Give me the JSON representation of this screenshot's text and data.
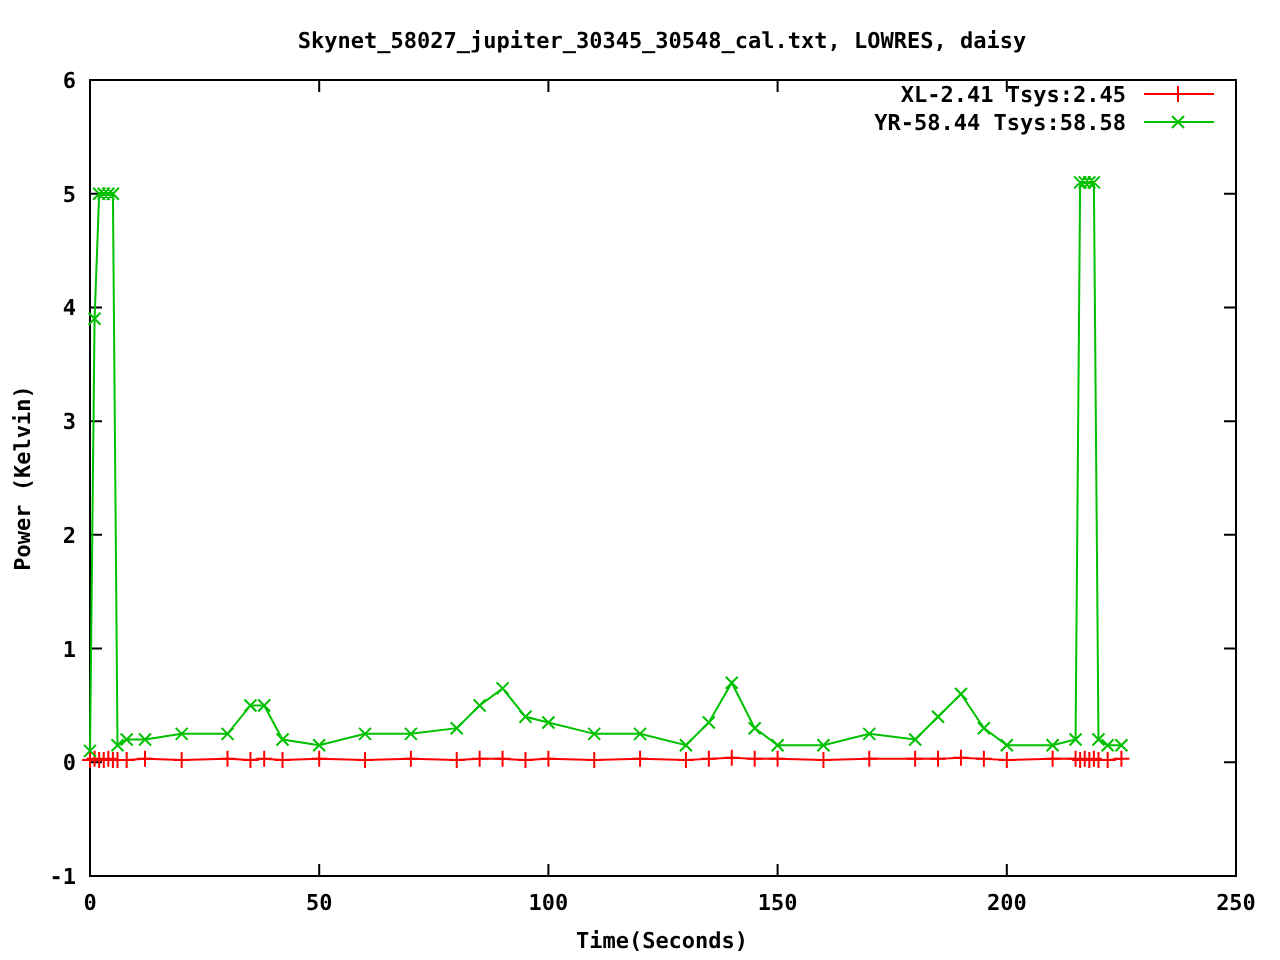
{
  "chart_data": {
    "type": "line",
    "title": "Skynet_58027_jupiter_30345_30548_cal.txt, LOWRES, daisy",
    "xlabel": "Time(Seconds)",
    "ylabel": "Power (Kelvin)",
    "x": [
      0,
      1,
      2,
      3,
      4,
      5,
      6,
      8,
      12,
      20,
      30,
      35,
      38,
      42,
      50,
      60,
      70,
      80,
      85,
      90,
      95,
      100,
      110,
      120,
      130,
      135,
      140,
      145,
      150,
      160,
      170,
      180,
      185,
      190,
      195,
      200,
      210,
      215,
      216,
      217,
      218,
      219,
      220,
      222,
      225
    ],
    "legend": true,
    "series": [
      {
        "name": "XL-2.41 Tsys:2.45",
        "color": "#ff0000",
        "marker": "plus",
        "values": [
          0.02,
          0.03,
          0.02,
          0.02,
          0.03,
          0.02,
          0.02,
          0.02,
          0.03,
          0.02,
          0.03,
          0.02,
          0.03,
          0.02,
          0.03,
          0.02,
          0.03,
          0.02,
          0.03,
          0.03,
          0.02,
          0.03,
          0.02,
          0.03,
          0.02,
          0.03,
          0.04,
          0.03,
          0.03,
          0.02,
          0.03,
          0.03,
          0.03,
          0.04,
          0.03,
          0.02,
          0.03,
          0.03,
          0.02,
          0.03,
          0.02,
          0.03,
          0.02,
          0.02,
          0.03
        ]
      },
      {
        "name": "YR-58.44 Tsys:58.58",
        "color": "#00c000",
        "marker": "cross",
        "values": [
          0.1,
          3.9,
          5.0,
          5.0,
          5.0,
          5.0,
          0.15,
          0.2,
          0.2,
          0.25,
          0.25,
          0.5,
          0.5,
          0.2,
          0.15,
          0.25,
          0.25,
          0.3,
          0.5,
          0.65,
          0.4,
          0.35,
          0.25,
          0.25,
          0.15,
          0.35,
          0.7,
          0.3,
          0.15,
          0.15,
          0.25,
          0.2,
          0.4,
          0.6,
          0.3,
          0.15,
          0.15,
          0.2,
          5.1,
          5.1,
          5.1,
          5.1,
          0.2,
          0.15,
          0.15
        ]
      }
    ],
    "xlim": [
      0,
      250
    ],
    "ylim": [
      -1,
      6
    ],
    "xticks": [
      0,
      50,
      100,
      150,
      200,
      250
    ],
    "yticks": [
      -1,
      0,
      1,
      2,
      3,
      4,
      5,
      6
    ]
  }
}
